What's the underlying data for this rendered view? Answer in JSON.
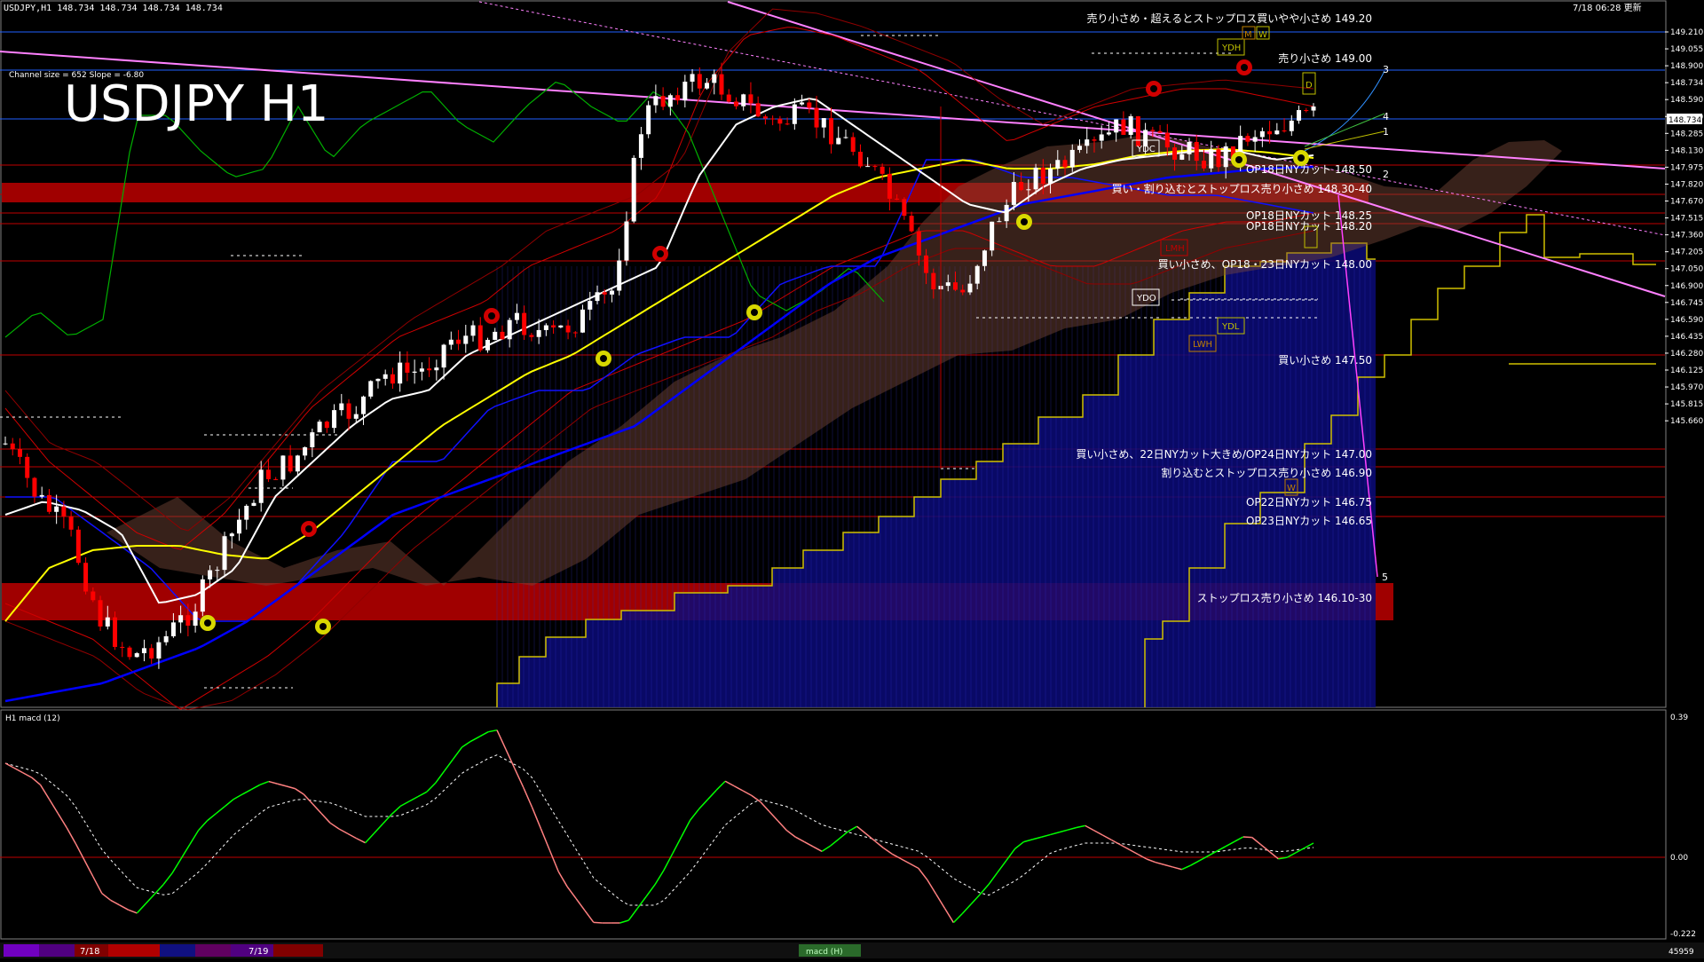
{
  "header": {
    "symbol_info": "USDJPY,H1  148.734 148.734 148.734 148.734",
    "server_time": "7/18 06:28 更新",
    "channel_info": "Channel size = 652 Slope = -6.80",
    "big_title": "USDJPY H1"
  },
  "indicator": {
    "label": "H1  macd (12)",
    "scale_top": "0.39",
    "scale_zero": "0.00",
    "scale_bottom": "-0.222"
  },
  "footer": {
    "date_label_1": "7/18",
    "date_label_2": "7/19",
    "tab_label": "macd (H)",
    "counter": "45959"
  },
  "colors": {
    "background": "#000000",
    "bull_candle": "#ffffff",
    "bear_candle": "#ff0000",
    "ma_fast": "#ffffff",
    "ma_mid": "#ffff00",
    "ma_slow": "#0000ff",
    "channel": "#ff80ff",
    "cloud": "#0000a0",
    "level_line": "#c00000",
    "zone": "#a00000",
    "chikou": "#00c000",
    "macd_up": "#00ff00",
    "macd_down": "#ff8080"
  },
  "price_axis": {
    "ticks": [
      "149.210",
      "149.055",
      "148.900",
      "148.734",
      "148.590",
      "148.440",
      "148.285",
      "148.130",
      "147.975",
      "147.820",
      "147.670",
      "147.515",
      "147.360",
      "147.205",
      "147.050",
      "146.900",
      "146.745",
      "146.590",
      "146.435",
      "146.280",
      "146.125",
      "145.970",
      "145.815",
      "145.660"
    ],
    "current_price": "148.734"
  },
  "annotations": [
    {
      "text": "売り小さめ・超えるとストップロス買いやや小さめ 149.20"
    },
    {
      "text": "売り小さめ 149.00"
    },
    {
      "text": "OP18日NYカット 148.50"
    },
    {
      "text": "買い・割り込むとストップロス売り小さめ 148.30-40"
    },
    {
      "text": "OP18日NYカット 148.25"
    },
    {
      "text": "OP18日NYカット 148.20"
    },
    {
      "text": "買い小さめ、OP18・23日NYカット 148.00"
    },
    {
      "text": "買い小さめ 147.50"
    },
    {
      "text": "買い小さめ、22日NYカット大きめ/OP24日NYカット 147.00"
    },
    {
      "text": "割り込むとストップロス売り小さめ 146.90"
    },
    {
      "text": "OP22日NYカット 146.75"
    },
    {
      "text": "OP23日NYカット 146.65"
    },
    {
      "text": "ストップロス売り小さめ 146.10-30"
    }
  ],
  "markers": {
    "ydh": "YDH",
    "ydc": "YDC",
    "ydo": "YDO",
    "ydl": "YDL",
    "lmh": "LMH",
    "lwh": "LWH",
    "d_box": "D",
    "w_box": "W",
    "m_box": "M",
    "ww_box": "W",
    "proj_1": "1",
    "proj_2": "2",
    "proj_3": "3",
    "proj_4": "4",
    "proj_5": "5"
  }
}
